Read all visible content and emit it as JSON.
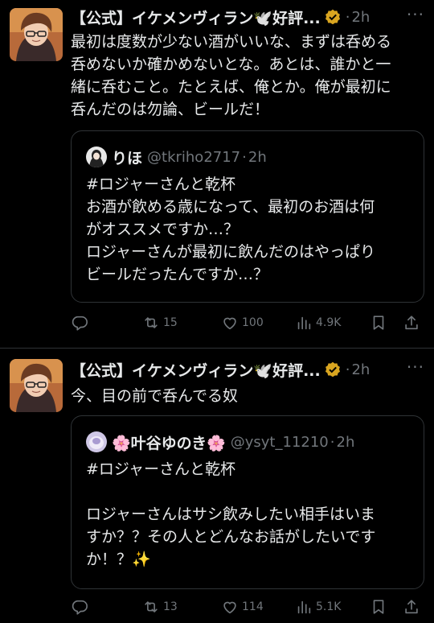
{
  "tweets": [
    {
      "author": "【公式】イケメンヴィラン🕊️好評...",
      "time": "2h",
      "text": "最初は度数が少ない酒がいいな、まずは呑める\n呑めないか確かめないとな。あとは、誰かと一\n緒に呑むこと。たとえば、俺とか。俺が最初に\n呑んだのは勿論、ビールだ！",
      "quote": {
        "author": "りほ",
        "handle": "@tkriho2717",
        "time": "2h",
        "text": "#ロジャーさんと乾杯\nお酒が飲める歳になって、最初のお酒は何\nがオススメですか…？\nロジャーさんが最初に飲んだのはやっぱり\nビールだったんですか…？"
      },
      "stats": {
        "retweets": "15",
        "likes": "100",
        "views": "4.9K"
      }
    },
    {
      "author": "【公式】イケメンヴィラン🕊️好評...",
      "time": "2h",
      "text": "今、目の前で呑んでる奴",
      "quote": {
        "author": "🌸叶谷ゆのき🌸",
        "handle": "@ysyt_11210",
        "time": "2h",
        "text": "#ロジャーさんと乾杯\n\nロジャーさんはサシ飲みしたい相手はいま\nすか？？その人とどんなお話がしたいです\nか！？✨"
      },
      "stats": {
        "retweets": "13",
        "likes": "114",
        "views": "5.1K"
      }
    }
  ],
  "icons": {
    "verified": "verified-badge-icon",
    "more": "more-icon",
    "reply": "reply-icon",
    "retweet": "retweet-icon",
    "like": "like-icon",
    "views": "views-icon",
    "bookmark": "bookmark-icon",
    "share": "share-icon"
  },
  "colors": {
    "background": "#000000",
    "text": "#e7e9ea",
    "secondary": "#71767b",
    "border": "#2f3336",
    "verified_gold": "#d9a520"
  },
  "more_glyph": "···",
  "dot": "·"
}
